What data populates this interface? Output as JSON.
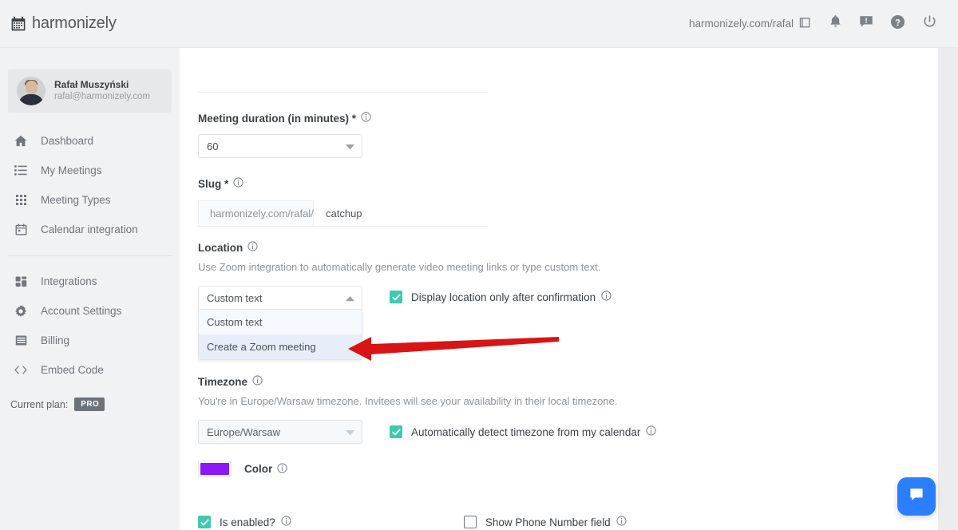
{
  "header": {
    "brand": "harmonizely",
    "brand_icon": "calendar-icon",
    "account_url": "harmonizely.com/rafal",
    "copy_icon": "copy-icon",
    "notifications_icon": "bell-icon",
    "feedback_icon": "feedback-icon",
    "help_icon": "question-circle-icon",
    "logout_icon": "power-icon"
  },
  "sidebar": {
    "profile": {
      "name": "Rafał Muszyński",
      "email": "rafal@harmonizely.com"
    },
    "items": [
      {
        "label": "Dashboard",
        "icon": "home-icon"
      },
      {
        "label": "My Meetings",
        "icon": "list-icon"
      },
      {
        "label": "Meeting Types",
        "icon": "grid-icon"
      },
      {
        "label": "Calendar integration",
        "icon": "calendar-icon"
      },
      {
        "label": "Integrations",
        "icon": "blocks-icon"
      },
      {
        "label": "Account Settings",
        "icon": "gear-icon"
      },
      {
        "label": "Billing",
        "icon": "card-icon"
      },
      {
        "label": "Embed Code",
        "icon": "code-icon"
      }
    ],
    "plan_label": "Current plan:",
    "plan_badge": "PRO"
  },
  "form": {
    "duration": {
      "label": "Meeting duration (in minutes) *",
      "value": "60"
    },
    "slug": {
      "label": "Slug *",
      "prefix": "harmonizely.com/rafal/",
      "value": "catchup",
      "placeholder": "catchup"
    },
    "location": {
      "label": "Location",
      "hint": "Use Zoom integration to automatically generate video meeting links or type custom text.",
      "value": "Custom text",
      "options": [
        "Custom text",
        "Create a Zoom meeting"
      ],
      "highlighted_option": "Create a Zoom meeting",
      "checkbox": {
        "label": "Display location only after confirmation",
        "checked": true
      }
    },
    "timezone": {
      "label": "Timezone",
      "hint": "You're in Europe/Warsaw timezone. Invitees will see your availability in their local timezone.",
      "value": "Europe/Warsaw",
      "disabled": true,
      "checkbox": {
        "label": "Automatically detect timezone from my calendar",
        "checked": true
      }
    },
    "color": {
      "label": "Color",
      "value": "#8c17f7"
    },
    "is_enabled": {
      "label": "Is enabled?",
      "checked": true
    },
    "show_phone": {
      "label": "Show Phone Number field",
      "checked": false
    }
  },
  "annotation": {
    "arrow_color": "#d81414",
    "points_at": "Create a Zoom meeting"
  },
  "chat": {
    "icon": "chat-bubble-icon",
    "color": "#2b7fff"
  }
}
